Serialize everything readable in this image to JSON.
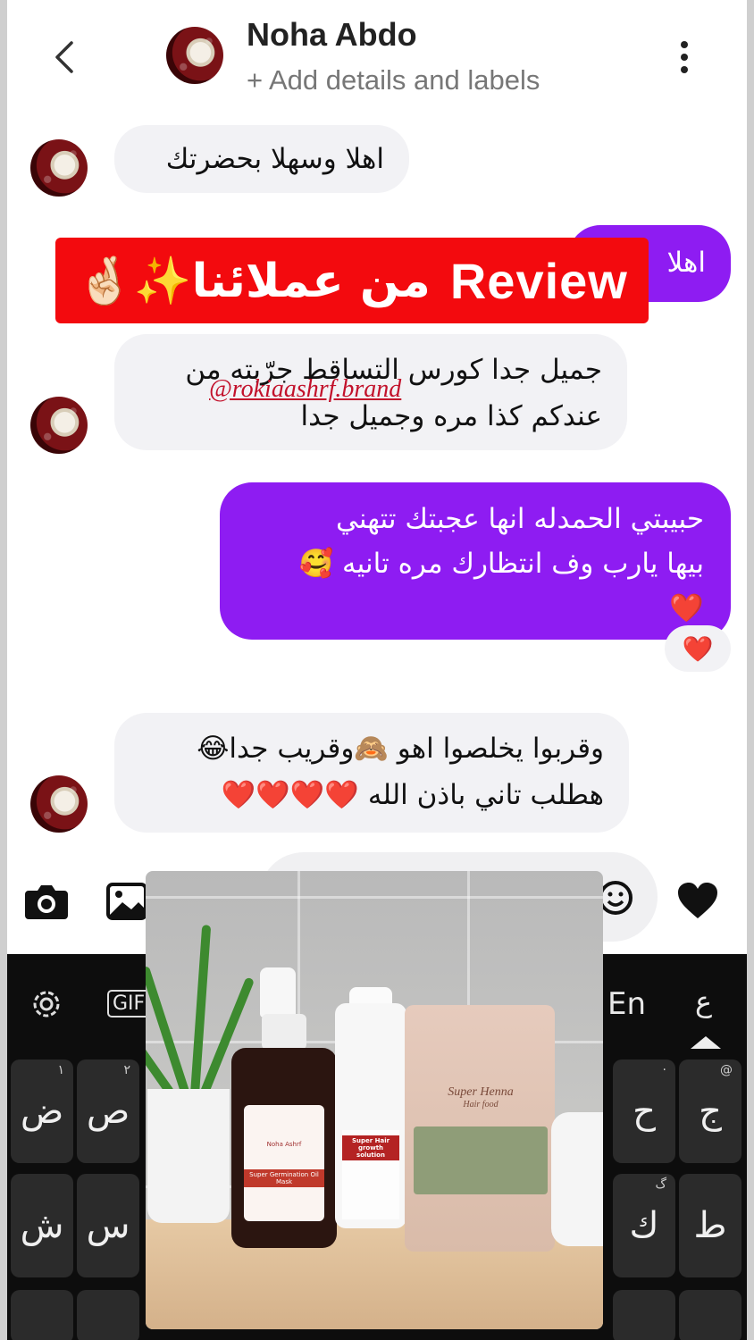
{
  "header": {
    "contact_name": "Noha Abdo",
    "subtitle": "+ Add details and labels"
  },
  "messages": [
    {
      "direction": "in",
      "text": "اهلا وسهلا بحضرتك"
    },
    {
      "direction": "out",
      "text": "اهلا"
    },
    {
      "direction": "in",
      "lines": [
        "جميل جدا كورس التساقط جرّبته من",
        "عندكم كذا مره وجميل جدا"
      ]
    },
    {
      "direction": "out",
      "lines": [
        "حبيبتي الحمدله انها عجبتك تتهني",
        "بيها يارب وف انتظارك مره تانيه 🥰",
        "❤️"
      ]
    },
    {
      "direction": "in",
      "lines": [
        "وقربوا يخلصوا اهو 🙈وقريب جدا😂",
        "هطلب تاني باذن الله ❤️❤️❤️❤️"
      ]
    }
  ],
  "reaction": "❤️",
  "banner": {
    "review": "Review",
    "arabic": "من عملائنا✨🤞🏻"
  },
  "watermark": "@rokiaashrf.brand",
  "composer": {
    "camera_icon": "camera-icon",
    "gallery_icon": "gallery-icon",
    "emoji_icon": "emoji-icon",
    "heart_icon": "heart-icon"
  },
  "keyboard": {
    "gif": "GIF",
    "lang_en": "En",
    "lang_ar": "ع",
    "keys": [
      {
        "char": "ض",
        "hint": "١"
      },
      {
        "char": "ص",
        "hint": "٢"
      },
      {
        "char": "ح",
        "hint": "·"
      },
      {
        "char": "ج",
        "hint": "@"
      },
      {
        "char": "ش",
        "hint": ""
      },
      {
        "char": "س",
        "hint": ""
      },
      {
        "char": "ك",
        "hint": "گ"
      },
      {
        "char": "ط",
        "hint": ""
      }
    ]
  },
  "product_photo": {
    "oil_brand": "Noha Ashrf",
    "oil_label": "Super Germination Oil Mask",
    "solution_label": "Super Hair growth solution",
    "henna_label": "Super Henna",
    "henna_sub": "Hair food"
  }
}
